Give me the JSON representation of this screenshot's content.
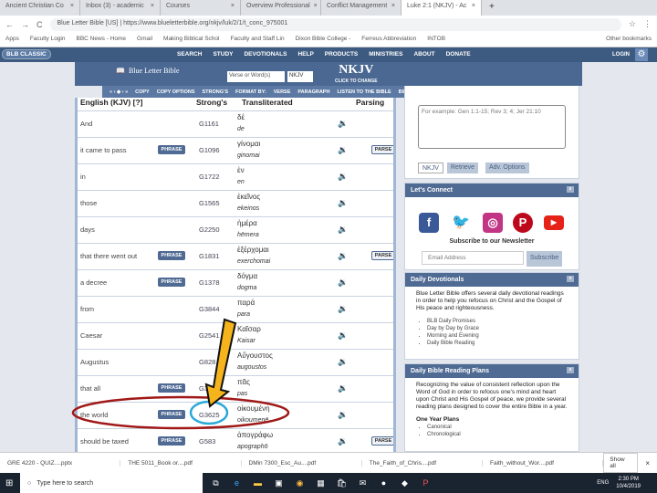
{
  "browser": {
    "tabs": [
      "Ancient Christian Co",
      "Inbox (3) - academic",
      "Courses",
      "Overview Professional",
      "Conflict Management",
      "Luke 2:1 (NKJV) - Ac"
    ],
    "url": "https://www.blueletterbible.org/nkjv/luk/2/1/t_conc_975001",
    "url_prefix": "Blue Letter Bible [US]",
    "bookmarks": [
      "Apps",
      "Faculty Login",
      "BBC News - Home",
      "Gmail",
      "Making Biblical Schol",
      "Faculty and Staff Lin",
      "Dixon Bible College -",
      "Ferreus Abbreviation",
      "INTOB",
      "Other bookmarks"
    ]
  },
  "site_nav": {
    "classic": "BLB CLASSIC",
    "items": [
      "SEARCH",
      "STUDY",
      "DEVOTIONALS",
      "HELP",
      "PRODUCTS",
      "MINISTRIES",
      "ABOUT",
      "DONATE"
    ],
    "login": "LOGIN"
  },
  "header": {
    "logo": "Blue Letter Bible",
    "search_placeholder": "Verse or Word(s)",
    "version": "NKJV",
    "version_big": "NKJV",
    "version_sub": "CLICK TO CHANGE"
  },
  "toolbar": [
    "« ‹ ◆ › »",
    "COPY",
    "COPY OPTIONS",
    "STRONG'S",
    "FORMAT BY:",
    "VERSE",
    "PARAGRAPH",
    "LISTEN TO THE BIBLE",
    "BIBLE TEXT"
  ],
  "table": {
    "headers": {
      "english": "English (KJV) [?]",
      "strongs": "Strong's",
      "translit": "Transliterated",
      "parsing": "Parsing"
    },
    "phrase_label": "PHRASE",
    "parse_label": "PARSE",
    "rows": [
      {
        "eng": "And",
        "str": "G1161",
        "grk": "δέ",
        "tr": "de",
        "phrase": false,
        "parse": false
      },
      {
        "eng": "it came to pass",
        "str": "G1096",
        "grk": "γίνομαι",
        "tr": "ginomai",
        "phrase": true,
        "parse": true
      },
      {
        "eng": "in",
        "str": "G1722",
        "grk": "ἐν",
        "tr": "en",
        "phrase": false,
        "parse": false
      },
      {
        "eng": "those",
        "str": "G1565",
        "grk": "ἐκεῖνος",
        "tr": "ekeinos",
        "phrase": false,
        "parse": false
      },
      {
        "eng": "days",
        "str": "G2250",
        "grk": "ἡμέρα",
        "tr": "hēmera",
        "phrase": false,
        "parse": false
      },
      {
        "eng": "that there went out",
        "str": "G1831",
        "grk": "ἐξέρχομαι",
        "tr": "exerchomai",
        "phrase": true,
        "parse": true
      },
      {
        "eng": "a decree",
        "str": "G1378",
        "grk": "δόγμα",
        "tr": "dogma",
        "phrase": true,
        "parse": false
      },
      {
        "eng": "from",
        "str": "G3844",
        "grk": "παρά",
        "tr": "para",
        "phrase": false,
        "parse": false
      },
      {
        "eng": "Caesar",
        "str": "G2541",
        "grk": "Καῖσαρ",
        "tr": "Kaisar",
        "phrase": false,
        "parse": false
      },
      {
        "eng": "Augustus",
        "str": "G828",
        "grk": "Αὔγουστος",
        "tr": "augoustos",
        "phrase": false,
        "parse": false
      },
      {
        "eng": "that all",
        "str": "G3956",
        "grk": "πᾶς",
        "tr": "pas",
        "phrase": true,
        "parse": false
      },
      {
        "eng": "the world",
        "str": "G3625",
        "grk": "οἰκουμένη",
        "tr": "oikoumenē",
        "phrase": true,
        "parse": false
      },
      {
        "eng": "should be taxed",
        "str": "G583",
        "grk": "ἀπογράφω",
        "tr": "apographō",
        "phrase": true,
        "parse": true
      }
    ]
  },
  "sidebar": {
    "lookup_placeholder": "For example: Gen 1:1-15; Rev 3; 4; Jer 21:10",
    "version": "NKJV",
    "retrieve": "Retrieve",
    "adv": "Adv. Options",
    "connect": {
      "title": "Let's Connect",
      "newsletter": "Subscribe to our Newsletter",
      "email_placeholder": "Email Address",
      "subscribe": "Subscribe"
    },
    "devotionals": {
      "title": "Daily Devotionals",
      "text": "Blue Letter Bible offers several daily devotional readings in order to help you refocus on Christ and the Gospel of His peace and righteousness.",
      "items": [
        "BLB Daily Promises",
        "Day by Day by Grace",
        "Morning and Evening",
        "Daily Bible Reading"
      ]
    },
    "plans": {
      "title": "Daily Bible Reading Plans",
      "text": "Recognizing the value of consistent reflection upon the Word of God in order to refocus one's mind and heart upon Christ and His Gospel of peace, we provide several reading plans designed to cover the entire Bible in a year.",
      "sub": "One Year Plans",
      "items": [
        "Canonical",
        "Chronological"
      ]
    }
  },
  "downloads": {
    "items": [
      "GRE 4220 - QUIZ....pptx",
      "THE 5011_Book or....pdf",
      "DMin 7300_Esc_Au....pdf",
      "The_Faith_of_Chris....pdf",
      "Faith_without_Wor....pdf"
    ],
    "show_all": "Show all"
  },
  "taskbar": {
    "search": "Type here to search",
    "lang": "ENG",
    "time": "2:30 PM",
    "date": "10/4/2019"
  },
  "annotation_colors": {
    "ellipse": "#a01818",
    "circle": "#2aa8d8",
    "arrow": "#f5b31c"
  }
}
